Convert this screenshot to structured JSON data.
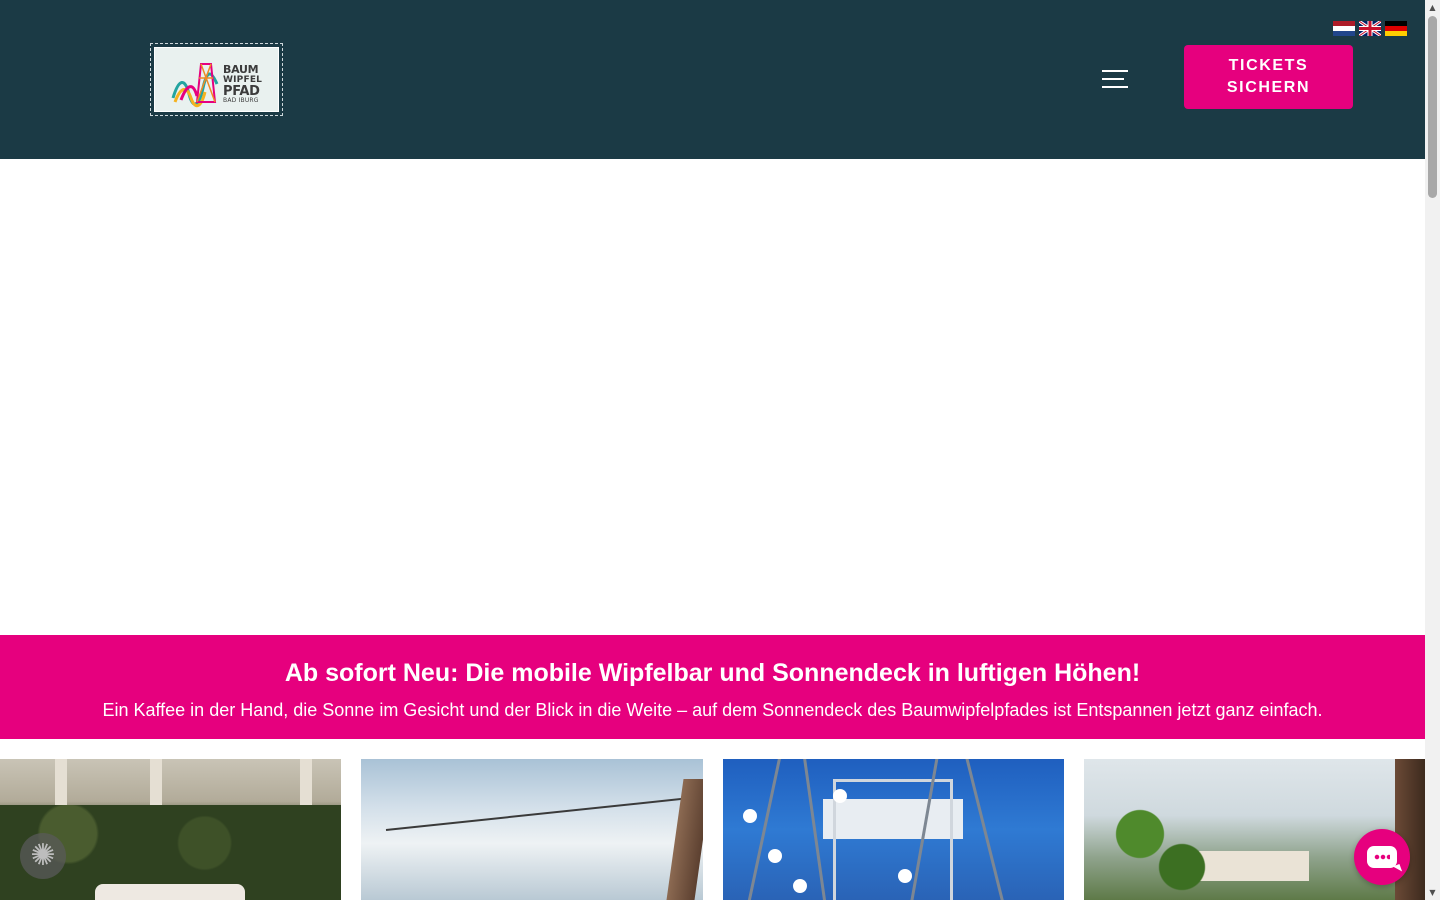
{
  "header": {
    "logo": {
      "line1": "BAUM",
      "line2": "WIPFEL",
      "line3": "PFAD",
      "line4": "BAD IBURG"
    },
    "languages": [
      {
        "code": "nl",
        "icon": "flag-netherlands-icon"
      },
      {
        "code": "en",
        "icon": "flag-uk-icon"
      },
      {
        "code": "de",
        "icon": "flag-germany-icon"
      }
    ],
    "menu_icon": "hamburger-menu-icon",
    "tickets_button": {
      "line1": "TICKETS",
      "line2": "SICHERN"
    }
  },
  "banner": {
    "title": "Ab sofort Neu: Die mobile Wipfelbar und Sonnendeck in luftigen Höhen!",
    "text": "Ein Kaffee in der Hand, die Sonne im Gesicht und der Blick in die Weite – auf dem Sonnendeck des Baumwipfelpfades ist Entspannen jetzt ganz einfach."
  },
  "gallery": [
    {
      "name": "gallery-image-lounge"
    },
    {
      "name": "gallery-image-sky-view"
    },
    {
      "name": "gallery-image-tower-blossoms"
    },
    {
      "name": "gallery-image-castle-view"
    }
  ],
  "widgets": {
    "cookie_settings_icon": "gear-icon",
    "chat_icon": "chat-bubble-icon"
  },
  "colors": {
    "header_bg": "#1b3a45",
    "accent_pink": "#e6007e",
    "text_light": "#ffffff"
  }
}
